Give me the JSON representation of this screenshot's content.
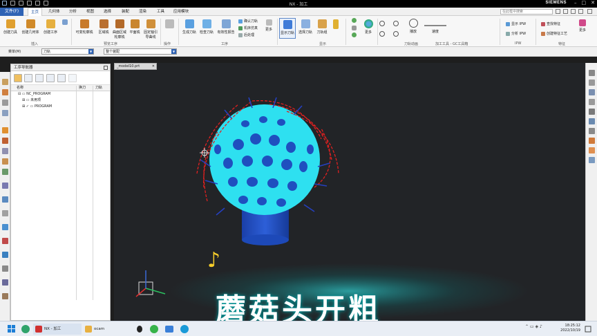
{
  "window": {
    "title": "NX - 加工",
    "brand": "SIEMENS"
  },
  "menu": {
    "file": "文件(F)",
    "tabs": [
      "主页",
      "几何体",
      "分析",
      "视图",
      "选择",
      "装配",
      "渲染",
      "工具",
      "应用模块"
    ],
    "search_placeholder": "在此框中搜索"
  },
  "ribbon": {
    "insert_group": {
      "label": "插入",
      "items": [
        "创建刀具",
        "创建几何体",
        "创建工序"
      ]
    },
    "wizard_group": {
      "label": "预览工序",
      "items": [
        "可变轮廓铣",
        "区域铣",
        "曲面区域轮廓铣",
        "平面铣",
        "固定轴引导曲线"
      ]
    },
    "ops_group": {
      "label": "操作"
    },
    "process_group": {
      "label": "工序",
      "items": [
        "生成刀轨",
        "检查刀轨",
        "有效性报告"
      ],
      "side_items": [
        "确认刀轨",
        "机床仿真",
        "后处理"
      ],
      "more": "更多"
    },
    "display_group": {
      "label": "显示",
      "items": [
        "显示刀轨",
        "选择刀轨",
        "刀轨组"
      ]
    },
    "anim_group": {
      "label": "刀轨动画",
      "more": "更多",
      "play": "播放",
      "speed": "速度"
    },
    "ipw_group": {
      "label": "IPW",
      "items": [
        "显示 IPW",
        "分析 IPW"
      ]
    },
    "feature_group": {
      "label": "特征",
      "items": [
        "查找特征",
        "创建特征工艺"
      ],
      "more": "更多"
    },
    "toolbox_label": "加工工具 - GC工具箱"
  },
  "selection_bar": {
    "menu_label": "菜单(M)",
    "filter_value": "刀轨",
    "scope_value": "整个装配"
  },
  "navigator": {
    "title": "工序导航器",
    "columns": [
      "名称",
      "换刀",
      "刀轨"
    ],
    "rows": [
      {
        "indent": 0,
        "label": "NC_PROGRAM"
      },
      {
        "indent": 1,
        "label": "未用项"
      },
      {
        "indent": 1,
        "label": "PROGRAM"
      }
    ]
  },
  "viewport": {
    "tab_label": "_model10.prt",
    "caption": "蘑菇头开粗"
  },
  "taskbar": {
    "apps": [
      "NX - 加工",
      "ocam"
    ],
    "time": "18:25:12",
    "date": "2022/10/19"
  },
  "colors": {
    "accent": "#2f63b5",
    "part_cyan": "#2ee0f0",
    "bosses": "#1f4fbf",
    "toolpath_red": "#e02020"
  }
}
